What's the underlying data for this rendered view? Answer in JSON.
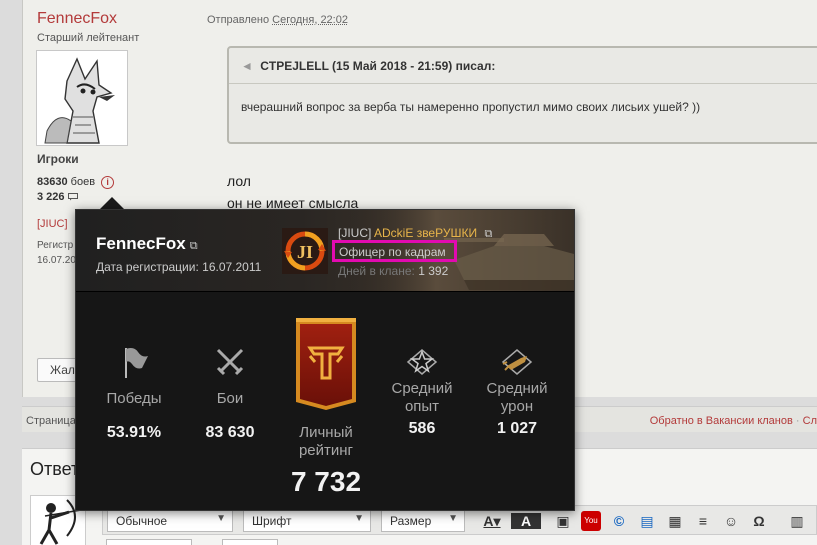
{
  "post": {
    "author_name": "FennecFox",
    "author_rank": "Старший лейтенант",
    "author_group": "Игроки",
    "battles_count": "83630",
    "battles_label": "боев",
    "posts_count": "3 226",
    "side_clan": "[JIUC]",
    "side_reg_label": "Регистр",
    "side_reg_date": "16.07.20",
    "complain_label": "Жало",
    "sent_label": "Отправлено",
    "sent_time": "Сегодня, 22:02",
    "quote_header": "CTPEJLELL (15 Май 2018 - 21:59) писал:",
    "quote_text": "вчерашний вопрос за верба ты намеренно пропустил мимо своих лисьих ушей? ))",
    "message_lines": [
      "лол",
      "он не имеет смысла"
    ]
  },
  "pagebar": {
    "pages_label": "Страница",
    "back_link": "Обратно в Вакансии кланов",
    "separator": "·",
    "next_stub": "Сл"
  },
  "reply": {
    "title": "Ответ",
    "format_select": "Обычное",
    "font_select": "Шрифт",
    "size_select": "Размер"
  },
  "card": {
    "name": "FennecFox",
    "reg_label": "Дата регистрации:",
    "reg_date": "16.07.2011",
    "clan_tag": "[JIUC]",
    "clan_name": "ADckiE звеРУШКИ",
    "clan_role": "Офицер по кадрам",
    "clan_days_label": "Дней в клане:",
    "clan_days": "1 392",
    "stats": {
      "wins_label": "Победы",
      "wins_value": "53.91%",
      "battles_label": "Бои",
      "battles_value": "83 630",
      "rating_label_1": "Личный",
      "rating_label_2": "рейтинг",
      "rating_value": "7 732",
      "xp_label_1": "Средний",
      "xp_label_2": "опыт",
      "xp_value": "586",
      "dmg_label_1": "Средний",
      "dmg_label_2": "урон",
      "dmg_value": "1 027"
    }
  },
  "colors": {
    "link_red": "#b33a3a",
    "clan_gold": "#e8b54a",
    "highlight_magenta": "#e20ab0",
    "card_bg": "#161616"
  }
}
